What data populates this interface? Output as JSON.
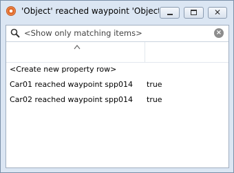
{
  "window": {
    "title": "'Object' reached waypoint 'Object' ...",
    "minimize_glyph": "—",
    "maximize_glyph": "□",
    "close_glyph": "✕"
  },
  "search": {
    "placeholder": "<Show only matching items>",
    "value": ""
  },
  "table": {
    "sort_indicator": "ascending",
    "create_row_label": "<Create new property row>",
    "rows": [
      {
        "name": "Car01 reached waypoint spp014",
        "value": "true"
      },
      {
        "name": "Car02 reached waypoint spp014",
        "value": "true"
      }
    ]
  },
  "icons": {
    "app": "app-logo-icon",
    "search": "search-icon",
    "clear": "clear-search-icon",
    "sort": "sort-ascending-icon"
  },
  "colors": {
    "titlebar": "#dbe6f3",
    "window_border": "#7a8fa8",
    "app_icon": "#e26b2a"
  }
}
